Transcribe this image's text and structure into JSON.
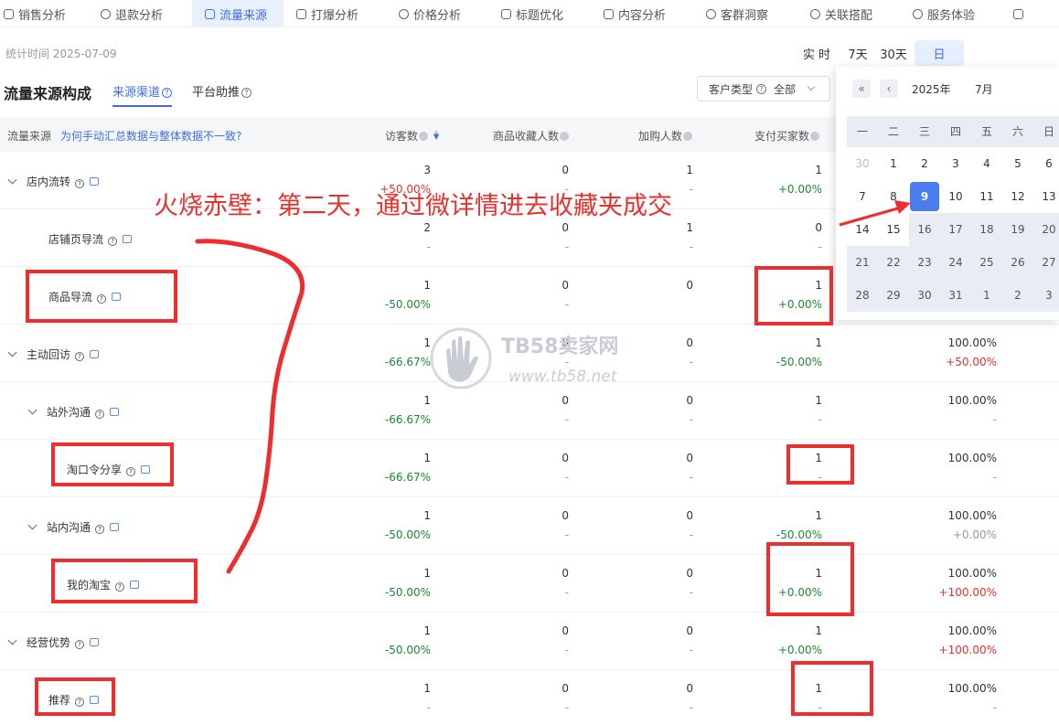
{
  "nav_tabs": [
    {
      "label": "销售分析",
      "active": false
    },
    {
      "label": "退款分析",
      "active": false
    },
    {
      "label": "流量来源",
      "active": true
    },
    {
      "label": "打爆分析",
      "active": false
    },
    {
      "label": "价格分析",
      "active": false
    },
    {
      "label": "标题优化",
      "active": false
    },
    {
      "label": "内容分析",
      "active": false
    },
    {
      "label": "客群洞察",
      "active": false
    },
    {
      "label": "关联搭配",
      "active": false
    },
    {
      "label": "服务体验",
      "active": false
    }
  ],
  "stat_time": "统计时间 2025-07-09",
  "period_buttons": [
    "实 时",
    "7天",
    "30天",
    "日"
  ],
  "section": {
    "title": "流量来源构成",
    "subtab_1": "来源渠道",
    "subtab_2": "平台助推"
  },
  "filter": {
    "label": "客户类型",
    "value": "全部"
  },
  "table": {
    "col_source": "流量来源",
    "faq_link": "为何手动汇总数据与整体数据不一致?",
    "headers": [
      "访客数",
      "商品收藏人数",
      "加购人数",
      "支付买家数"
    ]
  },
  "rows": [
    {
      "name": "店内流转",
      "level": 0,
      "expand": true,
      "visitors": "3",
      "visitors_chg": "+50.00%",
      "fav": "0",
      "fav_chg": "-",
      "cart": "1",
      "cart_chg": "-",
      "buyers": "1",
      "buyers_chg": "+0.00%",
      "rate": "",
      "rate_chg": ""
    },
    {
      "name": "店铺页导流",
      "level": 1,
      "expand": false,
      "visitors": "2",
      "visitors_chg": "-",
      "fav": "0",
      "fav_chg": "-",
      "cart": "1",
      "cart_chg": "-",
      "buyers": "0",
      "buyers_chg": "-",
      "rate": "",
      "rate_chg": ""
    },
    {
      "name": "商品导流",
      "level": 1,
      "expand": false,
      "visitors": "1",
      "visitors_chg": "-50.00%",
      "fav": "0",
      "fav_chg": "-",
      "cart": "0",
      "cart_chg": "",
      "buyers": "1",
      "buyers_chg": "+0.00%",
      "rate": "",
      "rate_chg": ""
    },
    {
      "name": "主动回访",
      "level": 0,
      "expand": true,
      "visitors": "1",
      "visitors_chg": "-66.67%",
      "fav": "0",
      "fav_chg": "-",
      "cart": "0",
      "cart_chg": "-",
      "buyers": "1",
      "buyers_chg": "-50.00%",
      "rate": "100.00%",
      "rate_chg": "+50.00%"
    },
    {
      "name": "站外沟通",
      "level": 1,
      "expand": true,
      "visitors": "1",
      "visitors_chg": "-66.67%",
      "fav": "0",
      "fav_chg": "-",
      "cart": "0",
      "cart_chg": "-",
      "buyers": "1",
      "buyers_chg": "-",
      "rate": "100.00%",
      "rate_chg": "-"
    },
    {
      "name": "淘口令分享",
      "level": 2,
      "expand": false,
      "visitors": "1",
      "visitors_chg": "-66.67%",
      "fav": "0",
      "fav_chg": "-",
      "cart": "0",
      "cart_chg": "-",
      "buyers": "1",
      "buyers_chg": "-",
      "rate": "100.00%",
      "rate_chg": "-"
    },
    {
      "name": "站内沟通",
      "level": 1,
      "expand": true,
      "visitors": "1",
      "visitors_chg": "-50.00%",
      "fav": "0",
      "fav_chg": "-",
      "cart": "0",
      "cart_chg": "-",
      "buyers": "1",
      "buyers_chg": "-50.00%",
      "rate": "100.00%",
      "rate_chg": "+0.00%"
    },
    {
      "name": "我的淘宝",
      "level": 2,
      "expand": false,
      "visitors": "1",
      "visitors_chg": "-50.00%",
      "fav": "0",
      "fav_chg": "-",
      "cart": "0",
      "cart_chg": "-",
      "buyers": "1",
      "buyers_chg": "+0.00%",
      "rate": "100.00%",
      "rate_chg": "+100.00%"
    },
    {
      "name": "经营优势",
      "level": 0,
      "expand": true,
      "visitors": "1",
      "visitors_chg": "-50.00%",
      "fav": "0",
      "fav_chg": "-",
      "cart": "0",
      "cart_chg": "-",
      "buyers": "1",
      "buyers_chg": "+0.00%",
      "rate": "100.00%",
      "rate_chg": "+100.00%"
    },
    {
      "name": "推荐",
      "level": 1,
      "expand": false,
      "visitors": "1",
      "visitors_chg": "-",
      "fav": "0",
      "fav_chg": "-",
      "cart": "0",
      "cart_chg": "-",
      "buyers": "1",
      "buyers_chg": "-",
      "rate": "100.00%",
      "rate_chg": "-"
    }
  ],
  "calendar": {
    "year": "2025年",
    "month": "7月",
    "weekdays": [
      "一",
      "二",
      "三",
      "四",
      "五",
      "六",
      "日"
    ],
    "days": [
      {
        "d": "30",
        "s": "dim"
      },
      {
        "d": "1",
        "s": "past"
      },
      {
        "d": "2",
        "s": "past"
      },
      {
        "d": "3",
        "s": "past"
      },
      {
        "d": "4",
        "s": "past"
      },
      {
        "d": "5",
        "s": "past"
      },
      {
        "d": "6",
        "s": "past"
      },
      {
        "d": "7",
        "s": "past"
      },
      {
        "d": "8",
        "s": "past"
      },
      {
        "d": "9",
        "s": "sel"
      },
      {
        "d": "10",
        "s": "past"
      },
      {
        "d": "11",
        "s": "past"
      },
      {
        "d": "12",
        "s": "past"
      },
      {
        "d": "13",
        "s": "past"
      },
      {
        "d": "14",
        "s": "past"
      },
      {
        "d": "15",
        "s": "past"
      },
      {
        "d": "16",
        "s": "future"
      },
      {
        "d": "17",
        "s": "future"
      },
      {
        "d": "18",
        "s": "future"
      },
      {
        "d": "19",
        "s": "future"
      },
      {
        "d": "20",
        "s": "future"
      },
      {
        "d": "21",
        "s": "future"
      },
      {
        "d": "22",
        "s": "future"
      },
      {
        "d": "23",
        "s": "future"
      },
      {
        "d": "24",
        "s": "future"
      },
      {
        "d": "25",
        "s": "future"
      },
      {
        "d": "26",
        "s": "future"
      },
      {
        "d": "27",
        "s": "future"
      },
      {
        "d": "28",
        "s": "future"
      },
      {
        "d": "29",
        "s": "future"
      },
      {
        "d": "30",
        "s": "future"
      },
      {
        "d": "31",
        "s": "future"
      },
      {
        "d": "1",
        "s": "future"
      },
      {
        "d": "2",
        "s": "future"
      },
      {
        "d": "3",
        "s": "future"
      }
    ]
  },
  "annotation": {
    "text": "火烧赤壁：第二天，通过微详情进去收藏夹成交",
    "color": "#e8302c"
  },
  "watermark": {
    "title": "TB58卖家网",
    "url": "www.tb58.net"
  },
  "colors": {
    "accent": "#3d6ee8",
    "up": "#e8302c",
    "down": "#1a8a2e",
    "highlight_box": "#ee2e2e"
  }
}
